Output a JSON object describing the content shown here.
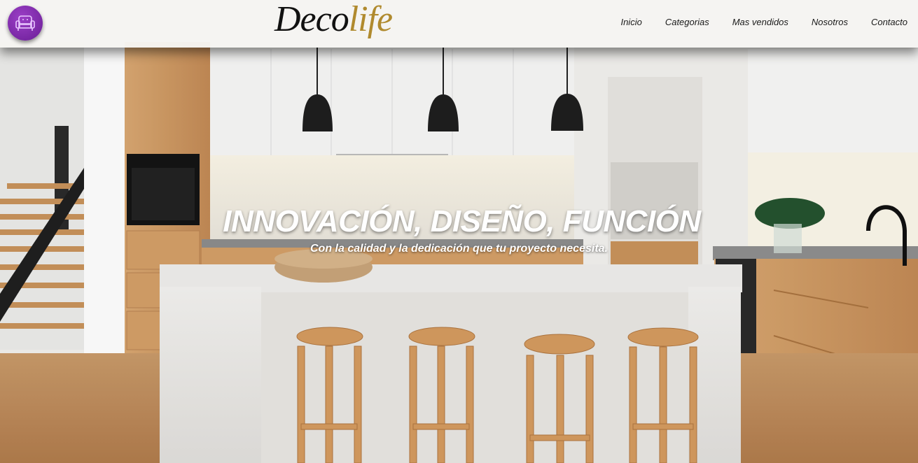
{
  "brand": {
    "part1": "Deco",
    "part2": "life"
  },
  "logo": {
    "icon": "armchair-icon",
    "color": "#7b2aa8"
  },
  "nav": {
    "items": [
      {
        "label": "Inicio"
      },
      {
        "label": "Categorias"
      },
      {
        "label": "Mas vendidos"
      },
      {
        "label": "Nosotros"
      },
      {
        "label": "Contacto"
      }
    ]
  },
  "hero": {
    "title": "INNOVACIÓN, DISEÑO, FUNCIÓN",
    "subtitle": "Con la calidad y la dedicación que tu proyecto necesita."
  },
  "colors": {
    "accent_gold": "#b08a2e",
    "navbar_bg": "#f5f4f2",
    "text_white": "#ffffff"
  }
}
